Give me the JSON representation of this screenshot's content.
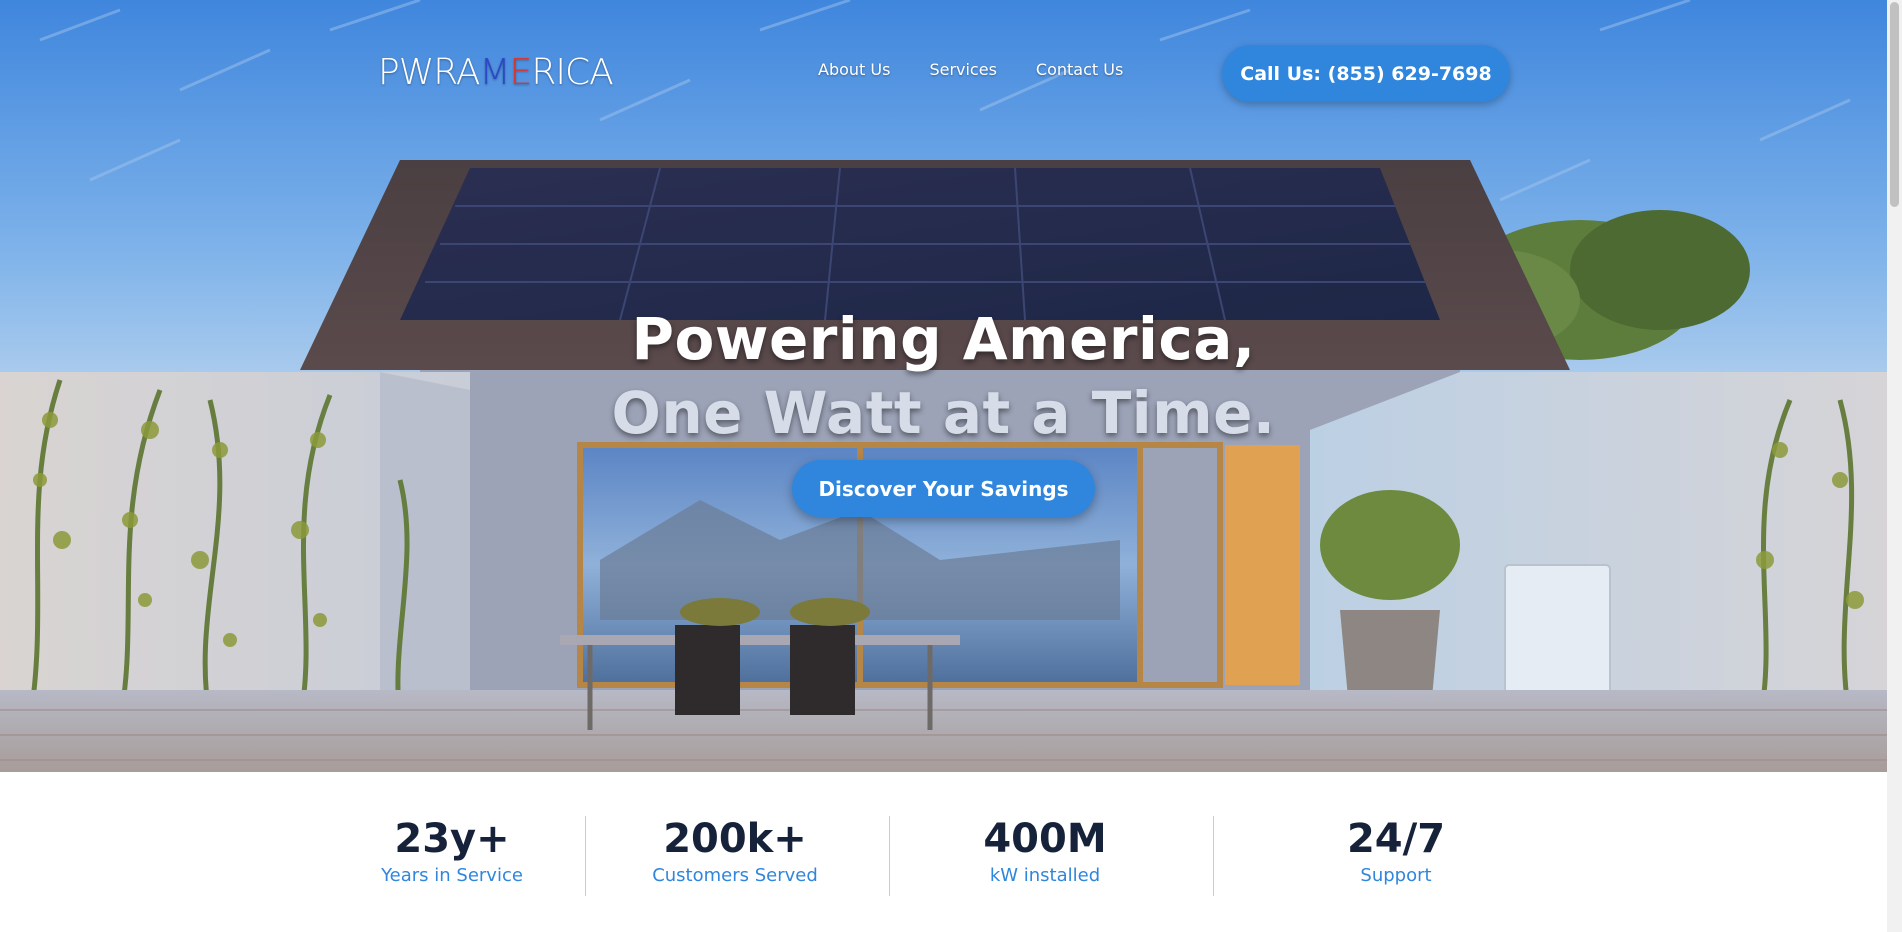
{
  "brand": {
    "logo_part1": "PWRA",
    "logo_part2": "M",
    "logo_part3": "E",
    "logo_part4": "RICA",
    "accent_color": "#2f86dc"
  },
  "nav": {
    "links": [
      "About Us",
      "Services",
      "Contact Us"
    ],
    "call_label": "Call Us: (855) 629-7698"
  },
  "hero": {
    "headline_line1": "Powering America,",
    "headline_line2": "One Watt at a Time.",
    "cta_label": "Discover Your Savings"
  },
  "stats": [
    {
      "value": "23y+",
      "label": "Years in Service"
    },
    {
      "value": "200k+",
      "label": "Customers Served"
    },
    {
      "value": "400M",
      "label": "kW installed"
    },
    {
      "value": "24/7",
      "label": "Support"
    }
  ]
}
